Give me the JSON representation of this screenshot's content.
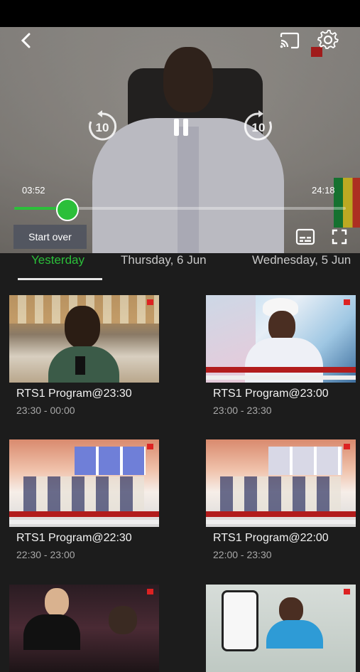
{
  "player": {
    "current_time": "03:52",
    "total_time": "24:18",
    "progress": 0.16,
    "rewind_label": "10",
    "forward_label": "10",
    "start_over_label": "Start over"
  },
  "tabs": [
    {
      "label": "Yesterday",
      "active": true
    },
    {
      "label": "Thursday, 6 Jun",
      "active": false
    },
    {
      "label": "Wednesday, 5 Jun",
      "active": false
    }
  ],
  "programs": [
    {
      "title": "RTS1 Program@23:30",
      "time": "23:30 - 00:00"
    },
    {
      "title": "RTS1 Program@23:00",
      "time": "23:00 - 23:30"
    },
    {
      "title": "RTS1 Program@22:30",
      "time": "22:30 - 23:00"
    },
    {
      "title": "RTS1 Program@22:00",
      "time": "22:00 - 23:30"
    }
  ],
  "colors": {
    "accent": "#2bbf3a",
    "background": "#1c1c1c"
  },
  "icons": [
    "back-icon",
    "cast-icon",
    "settings-icon",
    "rewind-10-icon",
    "pause-icon",
    "forward-10-icon",
    "subtitles-icon",
    "fullscreen-icon"
  ]
}
